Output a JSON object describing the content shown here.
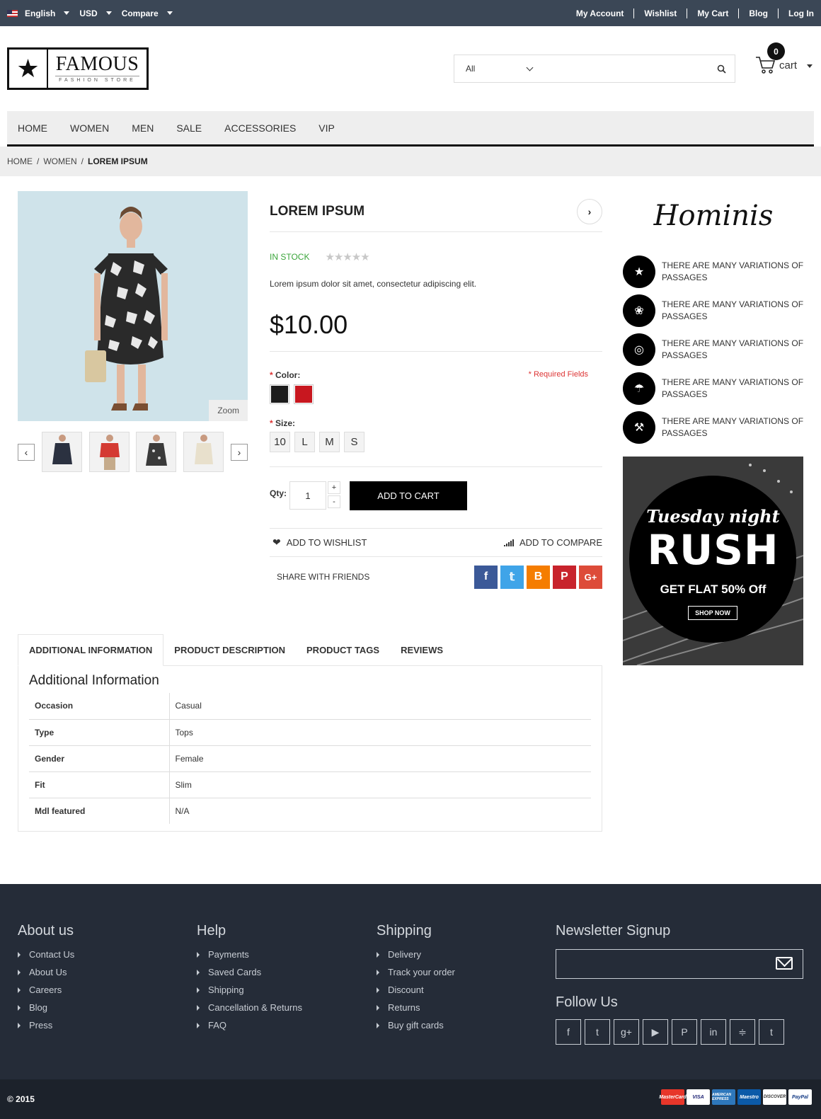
{
  "topbar": {
    "language": "English",
    "currency": "USD",
    "compare": "Compare",
    "links": [
      "My Account",
      "Wishlist",
      "My Cart",
      "Blog",
      "Log In"
    ]
  },
  "logo": {
    "name": "FAMOUS",
    "tagline": "FASHION STORE"
  },
  "search": {
    "category": "All",
    "placeholder": ""
  },
  "cart": {
    "count": "0",
    "label": "cart"
  },
  "nav": [
    "HOME",
    "WOMEN",
    "MEN",
    "SALE",
    "ACCESSORIES",
    "VIP"
  ],
  "breadcrumb": {
    "items": [
      "HOME",
      "WOMEN"
    ],
    "current": "LOREM IPSUM"
  },
  "gallery": {
    "zoom_label": "Zoom",
    "thumb_count": 4
  },
  "product": {
    "title": "LOREM IPSUM",
    "stock": "IN STOCK",
    "rating": "★★★★★",
    "description": "Lorem ipsum dolor sit amet, consectetur adipiscing elit.",
    "price": "$10.00",
    "color_label": "Color:",
    "required_note": "* Required Fields",
    "colors": [
      "#1c1c1c",
      "#c8171f"
    ],
    "size_label": "Size:",
    "sizes": [
      "10",
      "L",
      "M",
      "S"
    ],
    "qty_label": "Qty:",
    "qty": "1",
    "qty_plus": "+",
    "qty_minus": "-",
    "add_to_cart": "ADD TO CART",
    "add_to_wishlist": "ADD TO WISHLIST",
    "add_to_compare": "ADD TO COMPARE",
    "share": "SHARE WITH FRIENDS"
  },
  "share_colors": {
    "facebook": "#3b5998",
    "twitter": "#3fa4e8",
    "blogger": "#f57d00",
    "pinterest": "#c8232c",
    "googleplus": "#dd4b39"
  },
  "sidebar": {
    "brand": "Hominis",
    "features": [
      "THERE ARE MANY VARIATIONS OF PASSAGES",
      "THERE ARE MANY VARIATIONS OF PASSAGES",
      "THERE ARE MANY VARIATIONS OF PASSAGES",
      "THERE ARE MANY VARIATIONS OF PASSAGES",
      "THERE ARE MANY VARIATIONS OF PASSAGES"
    ],
    "banner": {
      "line1": "Tuesday night",
      "line2": "RUSH",
      "line3": "GET FLAT 50% Off",
      "button": "SHOP NOW"
    }
  },
  "tabs": {
    "items": [
      "ADDITIONAL INFORMATION",
      "PRODUCT DESCRIPTION",
      "PRODUCT TAGS",
      "REVIEWS"
    ],
    "heading": "Additional Information",
    "rows": [
      {
        "k": "Occasion",
        "v": "Casual"
      },
      {
        "k": "Type",
        "v": "Tops"
      },
      {
        "k": "Gender",
        "v": "Female"
      },
      {
        "k": "Fit",
        "v": "Slim"
      },
      {
        "k": "Mdl featured",
        "v": "N/A"
      }
    ]
  },
  "footer": {
    "about": {
      "title": "About us",
      "items": [
        "Contact Us",
        "About Us",
        "Careers",
        "Blog",
        "Press"
      ]
    },
    "help": {
      "title": "Help",
      "items": [
        "Payments",
        "Saved Cards",
        "Shipping",
        "Cancellation & Returns",
        "FAQ"
      ]
    },
    "shipping": {
      "title": "Shipping",
      "items": [
        "Delivery",
        "Track your order",
        "Discount",
        "Returns",
        "Buy gift cards"
      ]
    },
    "newsletter": {
      "title": "Newsletter Signup",
      "placeholder": ""
    },
    "follow": {
      "title": "Follow Us"
    },
    "copyright": "© 2015",
    "cards": [
      "MasterCard",
      "VISA",
      "AMERICAN EXPRESS",
      "Maestro",
      "DISCOVER",
      "PayPal"
    ]
  }
}
